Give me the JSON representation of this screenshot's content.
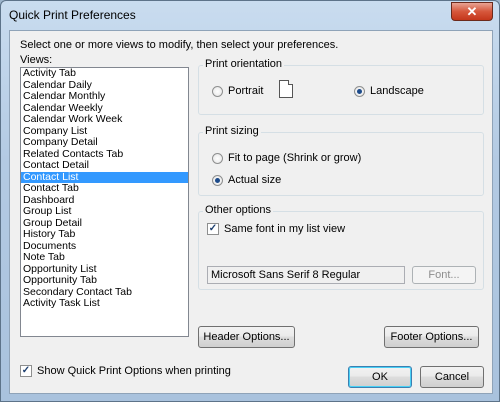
{
  "window": {
    "title": "Quick Print Preferences",
    "close_glyph": "✕"
  },
  "instruction": "Select one or more views to modify, then select your preferences.",
  "views": {
    "label": "Views:",
    "selected": "Contact List",
    "items": [
      "Activity Tab",
      "Calendar Daily",
      "Calendar Monthly",
      "Calendar Weekly",
      "Calendar Work Week",
      "Company List",
      "Company Detail",
      "Related Contacts Tab",
      "Contact Detail",
      "Contact List",
      "Contact Tab",
      "Dashboard",
      "Group List",
      "Group Detail",
      "History Tab",
      "Documents",
      "Note Tab",
      "Opportunity List",
      "Opportunity Tab",
      "Secondary Contact Tab",
      "Activity Task List"
    ]
  },
  "print_orientation": {
    "label": "Print orientation",
    "portrait": "Portrait",
    "landscape": "Landscape",
    "selected": "landscape",
    "page_icon": "page-icon"
  },
  "print_sizing": {
    "label": "Print sizing",
    "fit": "Fit to page (Shrink or grow)",
    "actual": "Actual size",
    "selected": "actual"
  },
  "other_options": {
    "label": "Other options",
    "same_font": "Same font in my list view",
    "same_font_checked": true,
    "font_value": "Microsoft Sans Serif 8 Regular",
    "font_button": "Font..."
  },
  "buttons": {
    "header": "Header Options...",
    "footer": "Footer Options...",
    "ok": "OK",
    "cancel": "Cancel"
  },
  "show_quick_print": {
    "label": "Show Quick Print Options when printing",
    "checked": true
  },
  "check_glyph": "✓"
}
